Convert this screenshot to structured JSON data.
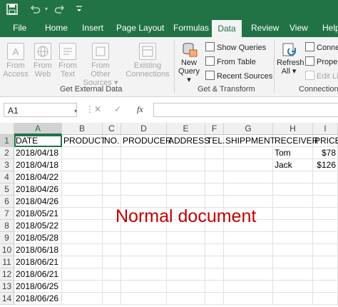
{
  "quick_access": [
    {
      "name": "save-icon",
      "glyph": "💾"
    },
    {
      "name": "undo-icon",
      "glyph": "↶"
    },
    {
      "name": "redo-icon",
      "glyph": "↷"
    },
    {
      "name": "customize-qat-icon",
      "glyph": "≡"
    }
  ],
  "tabs": [
    "File",
    "Home",
    "Insert",
    "Page Layout",
    "Formulas",
    "Data",
    "Review",
    "View",
    "Help"
  ],
  "active_tab": "Data",
  "ribbon": {
    "get_external_data": {
      "label": "Get External Data",
      "buttons": [
        {
          "line1": "From",
          "line2": "Access"
        },
        {
          "line1": "From",
          "line2": "Web"
        },
        {
          "line1": "From",
          "line2": "Text"
        },
        {
          "line1": "From Other",
          "line2": "Sources ▾"
        },
        {
          "line1": "Existing",
          "line2": "Connections"
        }
      ]
    },
    "get_transform": {
      "label": "Get & Transform",
      "new_query": {
        "line1": "New",
        "line2": "Query ▾"
      },
      "small": [
        "Show Queries",
        "From Table",
        "Recent Sources"
      ]
    },
    "connections": {
      "label": "Connections",
      "refresh": {
        "line1": "Refresh",
        "line2": "All ▾"
      },
      "small": [
        "Conne",
        "Prope",
        "Edit Li"
      ]
    }
  },
  "formula_bar": {
    "name_box": "A1",
    "cancel": "✕",
    "enter": "✓",
    "fx": "fx",
    "value": ""
  },
  "columns": [
    "A",
    "B",
    "C",
    "D",
    "E",
    "F",
    "G",
    "H",
    "I"
  ],
  "rows": [
    "1",
    "2",
    "3",
    "4",
    "5",
    "6",
    "7",
    "8",
    "9",
    "10",
    "11",
    "12",
    "13",
    "14"
  ],
  "cells": {
    "row1": [
      "DATE",
      "PRODUCT",
      "NO.",
      "PRODUCER",
      "ADDRESS",
      "TEL.",
      "SHIPPMENT",
      "RECEIVER",
      "PRICE"
    ],
    "colA": [
      "2018/04/18",
      "2018/04/18",
      "2018/04/22",
      "2018/04/26",
      "2018/04/26",
      "2018/05/21",
      "2018/05/22",
      "2018/05/28",
      "2018/06/18",
      "2018/06/21",
      "2018/06/21",
      "2018/06/25",
      "2018/06/26"
    ],
    "row2_receiver": "Tom",
    "row2_price": "$78",
    "row3_receiver": "Jack",
    "row3_price": "$126"
  },
  "overlay_text": "Normal document",
  "colors": {
    "accent": "#217346",
    "overlay": "#c00000"
  }
}
